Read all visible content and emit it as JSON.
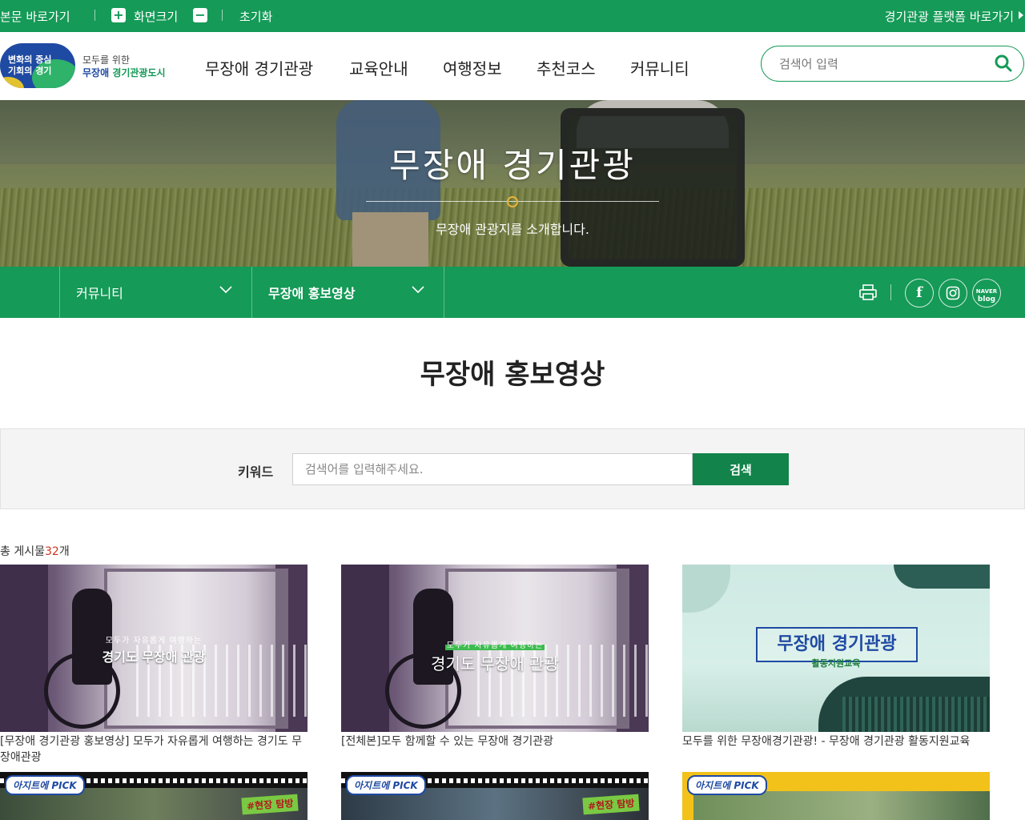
{
  "utility": {
    "skip_link": "본문 바로가기",
    "zoom_label": "화면크기",
    "zoom_in": "+",
    "zoom_out": "−",
    "reset": "초기화",
    "platform_link": "경기관광 플랫폼 바로가기"
  },
  "logo": {
    "badge_text_line1": "변화의 중심",
    "badge_text_line2": "기회의 경기",
    "sub_line1": "모두를 위한",
    "sub_line2_blue": "무장애",
    "sub_line2_green": "경기관광도시"
  },
  "gnb": [
    "무장애 경기관광",
    "교육안내",
    "여행정보",
    "추천코스",
    "커뮤니티"
  ],
  "header_search": {
    "placeholder": "검색어 입력"
  },
  "hero": {
    "title": "무장애 경기관광",
    "subtitle": "무장애 관광지를 소개합니다."
  },
  "location": {
    "depth1": "커뮤니티",
    "depth2": "무장애 홍보영상",
    "sns_blog_line1": "NAVER",
    "sns_blog_line2": "blog"
  },
  "page_title": "무장애 홍보영상",
  "search_form": {
    "label": "키워드",
    "placeholder": "검색어를 입력해주세요.",
    "button": "검색"
  },
  "total": {
    "prefix": "총 게시물",
    "count": "32",
    "suffix": "개"
  },
  "videos": [
    {
      "title": "[무장애 경기관광 홍보영상] 모두가 자유롭게 여행하는 경기도 무장애관광",
      "thumb_small": "모두가 자유롭게 여행하는",
      "thumb_big": "경기도 무장애 관광"
    },
    {
      "title": "[전체본]모두 함께할 수 있는 무장애 경기관광",
      "thumb_small": "모두가 자유롭게 여행하는",
      "thumb_big": "경기도 무장애 관광"
    },
    {
      "title": "모두를 위한 무장애경기관광! - 무장애 경기관광 활동지원교육",
      "thumb_big": "무장애 경기관광",
      "thumb_small": "활동지원교육"
    }
  ],
  "videos_row2": [
    {
      "badge": "아지트에 PICK",
      "tag": "#현장 탐방"
    },
    {
      "badge": "아지트에 PICK",
      "tag": "#현장 탐방"
    },
    {
      "badge": "아지트에 PICK"
    }
  ],
  "colors": {
    "brand_green": "#159a57",
    "button_green": "#12834a",
    "count_red": "#d2331f",
    "logo_blue": "#1f4aa3"
  }
}
